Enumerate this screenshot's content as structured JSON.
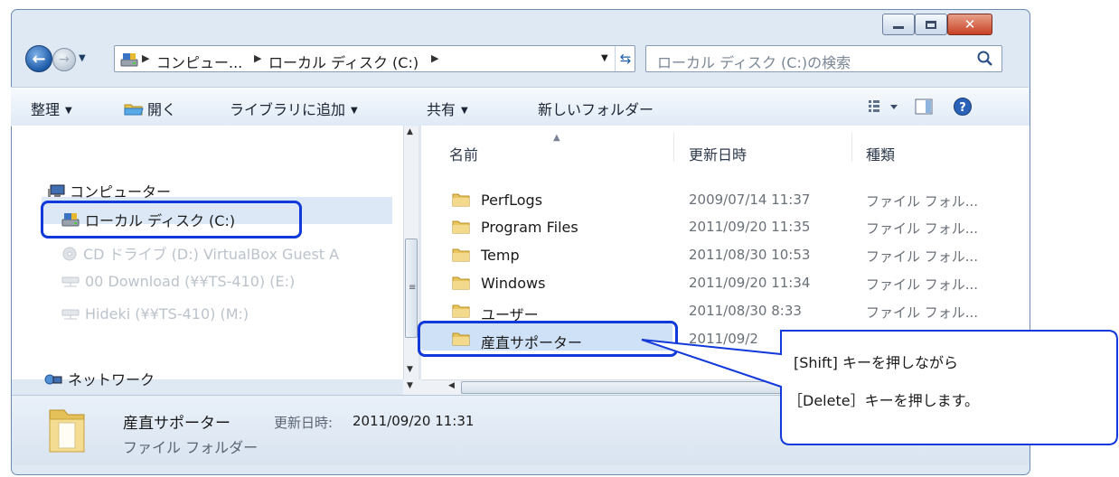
{
  "window": {
    "minimize": "minimize",
    "maximize": "maximize",
    "close": "✕"
  },
  "address": {
    "segments": [
      "コンピュー...",
      "ローカル ディスク (C:)"
    ],
    "search_placeholder": "ローカル ディスク (C:)の検索"
  },
  "toolbar": {
    "organize": "整理",
    "open": "開く",
    "add_to_library": "ライブラリに追加",
    "share": "共有",
    "new_folder": "新しいフォルダー"
  },
  "nav": {
    "computer": "コンピューター",
    "local_disk": "ローカル ディスク (C:)",
    "cd_drive": "CD ドライブ (D:) VirtualBox Guest A",
    "download_share": "00 Download (¥¥TS-410) (E:)",
    "hideki_share": "Hideki (¥¥TS-410) (M:)",
    "network": "ネットワーク"
  },
  "columns": {
    "name": "名前",
    "modified": "更新日時",
    "type": "種類"
  },
  "files": [
    {
      "name": "PerfLogs",
      "date": "2009/07/14 11:37",
      "type": "ファイル フォル..."
    },
    {
      "name": "Program Files",
      "date": "2011/09/20 11:35",
      "type": "ファイル フォル..."
    },
    {
      "name": "Temp",
      "date": "2011/08/30 10:53",
      "type": "ファイル フォル..."
    },
    {
      "name": "Windows",
      "date": "2011/09/20 11:34",
      "type": "ファイル フォル..."
    },
    {
      "name": "ユーザー",
      "date": "2011/08/30 8:33",
      "type": "ファイル フォル..."
    },
    {
      "name": "産直サポーター",
      "date": "2011/09/2",
      "type": ""
    }
  ],
  "details": {
    "name": "産直サポーター",
    "modified_label": "更新日時:",
    "modified_value": "2011/09/20 11:31",
    "type": "ファイル フォルダー"
  },
  "callout": {
    "line1": "[Shift] キーを押しながら",
    "line2": "［Delete］キーを押します。"
  },
  "colors": {
    "highlight_border": "#1239d9",
    "selection": "#cfe1f6"
  }
}
